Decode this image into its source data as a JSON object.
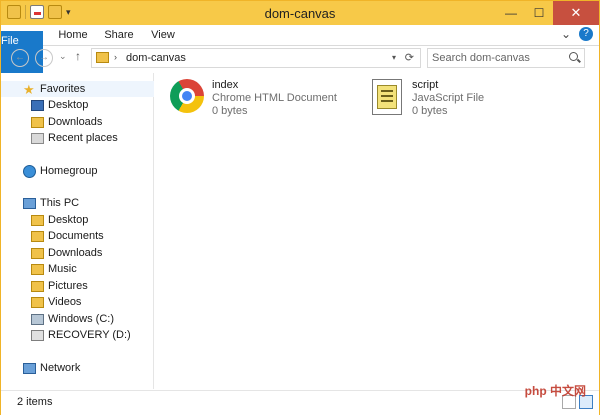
{
  "window": {
    "title": "dom-canvas",
    "controls": {
      "minimize": "—",
      "maximize": "☐",
      "close": "✕"
    }
  },
  "ribbon": {
    "tabs": [
      "File",
      "Home",
      "Share",
      "View"
    ],
    "expand_icon": "⌄",
    "help_icon": "?"
  },
  "address": {
    "back": "←",
    "forward": "→",
    "recent": "⌄",
    "up": "↑",
    "chevron": "›",
    "path": "dom-canvas",
    "dropdown": "▾",
    "refresh": "⟳"
  },
  "search": {
    "placeholder": "Search dom-canvas"
  },
  "nav": {
    "favorites": {
      "label": "Favorites",
      "items": [
        "Desktop",
        "Downloads",
        "Recent places"
      ]
    },
    "homegroup": {
      "label": "Homegroup"
    },
    "this_pc": {
      "label": "This PC",
      "items": [
        "Desktop",
        "Documents",
        "Downloads",
        "Music",
        "Pictures",
        "Videos",
        "Windows (C:)",
        "RECOVERY (D:)"
      ]
    },
    "network": {
      "label": "Network"
    }
  },
  "files": [
    {
      "name": "index",
      "type": "Chrome HTML Document",
      "size": "0 bytes",
      "icon": "chrome-icon"
    },
    {
      "name": "script",
      "type": "JavaScript File",
      "size": "0 bytes",
      "icon": "script-icon"
    }
  ],
  "status": {
    "count": "2 items"
  },
  "watermark": "php 中文网",
  "colors": {
    "titlebar": "#f7c948",
    "file_tab": "#1979ca",
    "close": "#c7503f"
  }
}
